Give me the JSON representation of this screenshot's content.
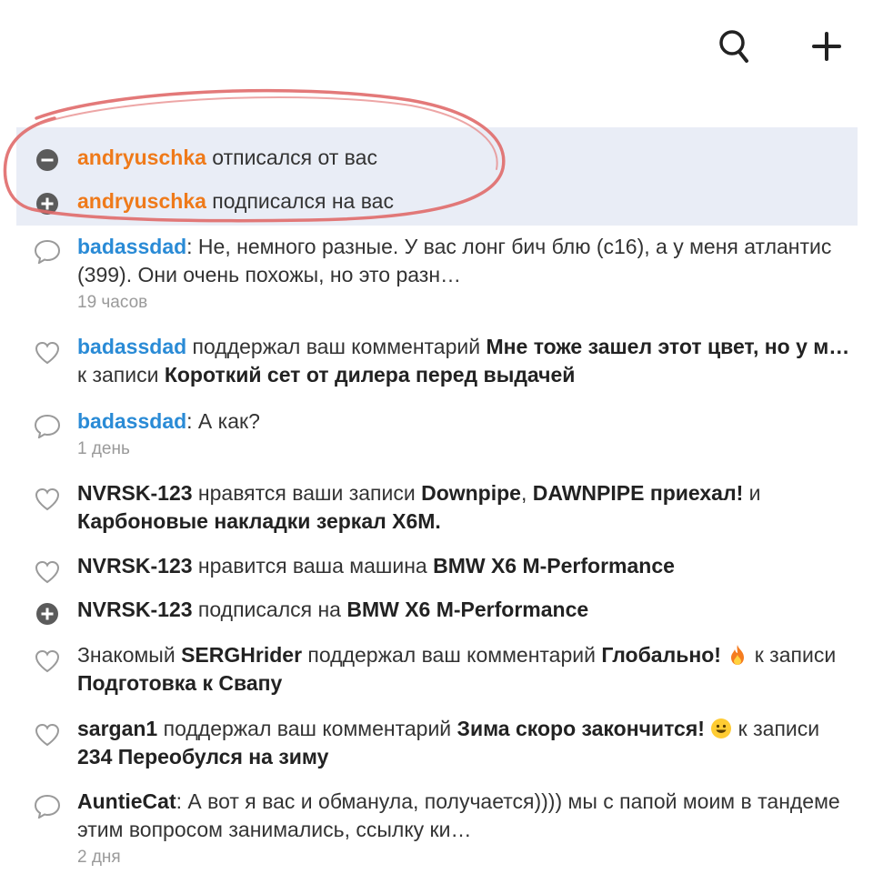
{
  "toolbar": {
    "search_icon": "search-icon",
    "add_icon": "plus-icon"
  },
  "colors": {
    "username_orange": "#ef7a1a",
    "username_blue": "#2a8bd6",
    "highlight_bg": "#e9edf6",
    "scribble_red": "#e06a6a"
  },
  "notifications": [
    {
      "icon": "minus-circle-icon",
      "user": "andryuschka",
      "text": " отписался от вас"
    },
    {
      "icon": "plus-circle-icon",
      "user": "andryuschka",
      "text": " подписался на вас"
    },
    {
      "icon": "comment-icon",
      "user": "badassdad",
      "text": ": Не, немного разные. У вас лонг бич блю (с16), а у меня атлантис (399). Они очень похожы, но это разн…",
      "time": "19 часов"
    },
    {
      "icon": "heart-icon",
      "user": "badassdad",
      "t1": " поддержал ваш комментарий ",
      "b1": "Мне тоже зашел этот цвет, но у м…",
      "t2": " к записи ",
      "b2": "Короткий сет от дилера перед выдачей"
    },
    {
      "icon": "comment-icon",
      "user": "badassdad",
      "text": ": А как?",
      "time": "1 день"
    },
    {
      "icon": "heart-icon",
      "user": "NVRSK-123",
      "t1": " нравятся ваши записи ",
      "b1": "Downpipe",
      "t2": ", ",
      "b2": "DAWNPIPE приехал!",
      "t3": " и ",
      "b3": "Карбоновые накладки зеркал X6M."
    },
    {
      "icon": "heart-icon",
      "user": "NVRSK-123",
      "t1": " нравится ваша машина ",
      "b1": "BMW X6 M-Performance"
    },
    {
      "icon": "plus-circle-icon",
      "user": "NVRSK-123",
      "t1": " подписался на ",
      "b1": "BMW X6 M-Performance"
    },
    {
      "icon": "heart-icon",
      "prefix": "Знакомый ",
      "user": "SERGHrider",
      "t1": " поддержал ваш комментарий ",
      "b1": "Глобально!",
      "t2": " к записи ",
      "b2": "Подготовка к Свапу"
    },
    {
      "icon": "heart-icon",
      "user": "sargan1",
      "t1": " поддержал ваш комментарий ",
      "b1": "Зима скоро закончится!",
      "t2": " к записи ",
      "b2": "234 Переобулся на зиму"
    },
    {
      "icon": "comment-icon",
      "user": "AuntieCat",
      "text": ": А вот я вас и обманула, получается)))) мы с папой моим в тандеме этим вопросом занимались, ссылку ки…",
      "time": "2 дня"
    }
  ]
}
